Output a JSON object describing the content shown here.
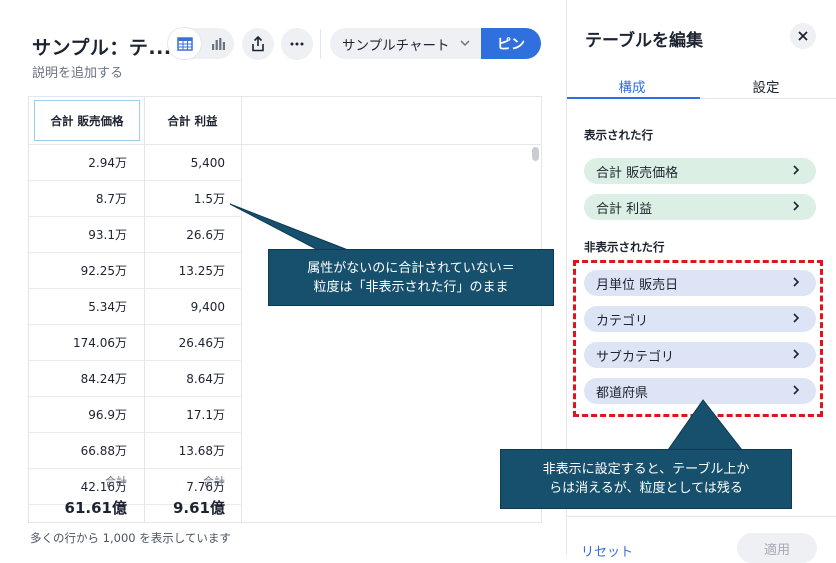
{
  "header": {
    "title": "サンプル：テ...",
    "subtitle": "説明を追加する",
    "chart_select": "サンプルチャート",
    "pin_label": "ピン"
  },
  "icons": {
    "table_view": "table-icon",
    "chart_view": "bar-chart-icon",
    "share": "share-icon",
    "more": "more-icon",
    "chevron": "chevron-down-icon",
    "close": "close-icon",
    "row_arrow": "chevron-right-icon"
  },
  "table": {
    "columns": [
      "合計 販売価格",
      "合計 利益"
    ],
    "rows": [
      [
        "2.94万",
        "5,400"
      ],
      [
        "8.7万",
        "1.5万"
      ],
      [
        "93.1万",
        "26.6万"
      ],
      [
        "92.25万",
        "13.25万"
      ],
      [
        "5.34万",
        "9,400"
      ],
      [
        "174.06万",
        "26.46万"
      ],
      [
        "84.24万",
        "8.64万"
      ],
      [
        "96.9万",
        "17.1万"
      ],
      [
        "66.88万",
        "13.68万"
      ],
      [
        "42.16万",
        "7.76万"
      ]
    ],
    "totals": [
      {
        "label": "合計",
        "value": "61.61億"
      },
      {
        "label": "合計",
        "value": "9.61億"
      }
    ],
    "footer_note": "多くの行から 1,000 を表示しています"
  },
  "callouts": {
    "a": [
      "属性がないのに合計されていない＝",
      "粒度は「非表示された行」のまま"
    ],
    "b": [
      "非表示に設定すると、テーブル上か",
      "らは消えるが、粒度としては残る"
    ]
  },
  "panel": {
    "title": "テーブルを編集",
    "tabs": [
      "構成",
      "設定"
    ],
    "shown_label": "表示された行",
    "shown_rows": [
      "合計 販売価格",
      "合計 利益"
    ],
    "hidden_label": "非表示された行",
    "hidden_rows": [
      "月単位 販売日",
      "カテゴリ",
      "サブカテゴリ",
      "都道府県"
    ],
    "reset": "リセット",
    "apply": "適用"
  },
  "colors": {
    "accent": "#2f6fde",
    "callout": "#17506d",
    "highlight": "#e0141e",
    "shown_pill": "#dcefe4",
    "hidden_pill": "#dde4f5"
  }
}
